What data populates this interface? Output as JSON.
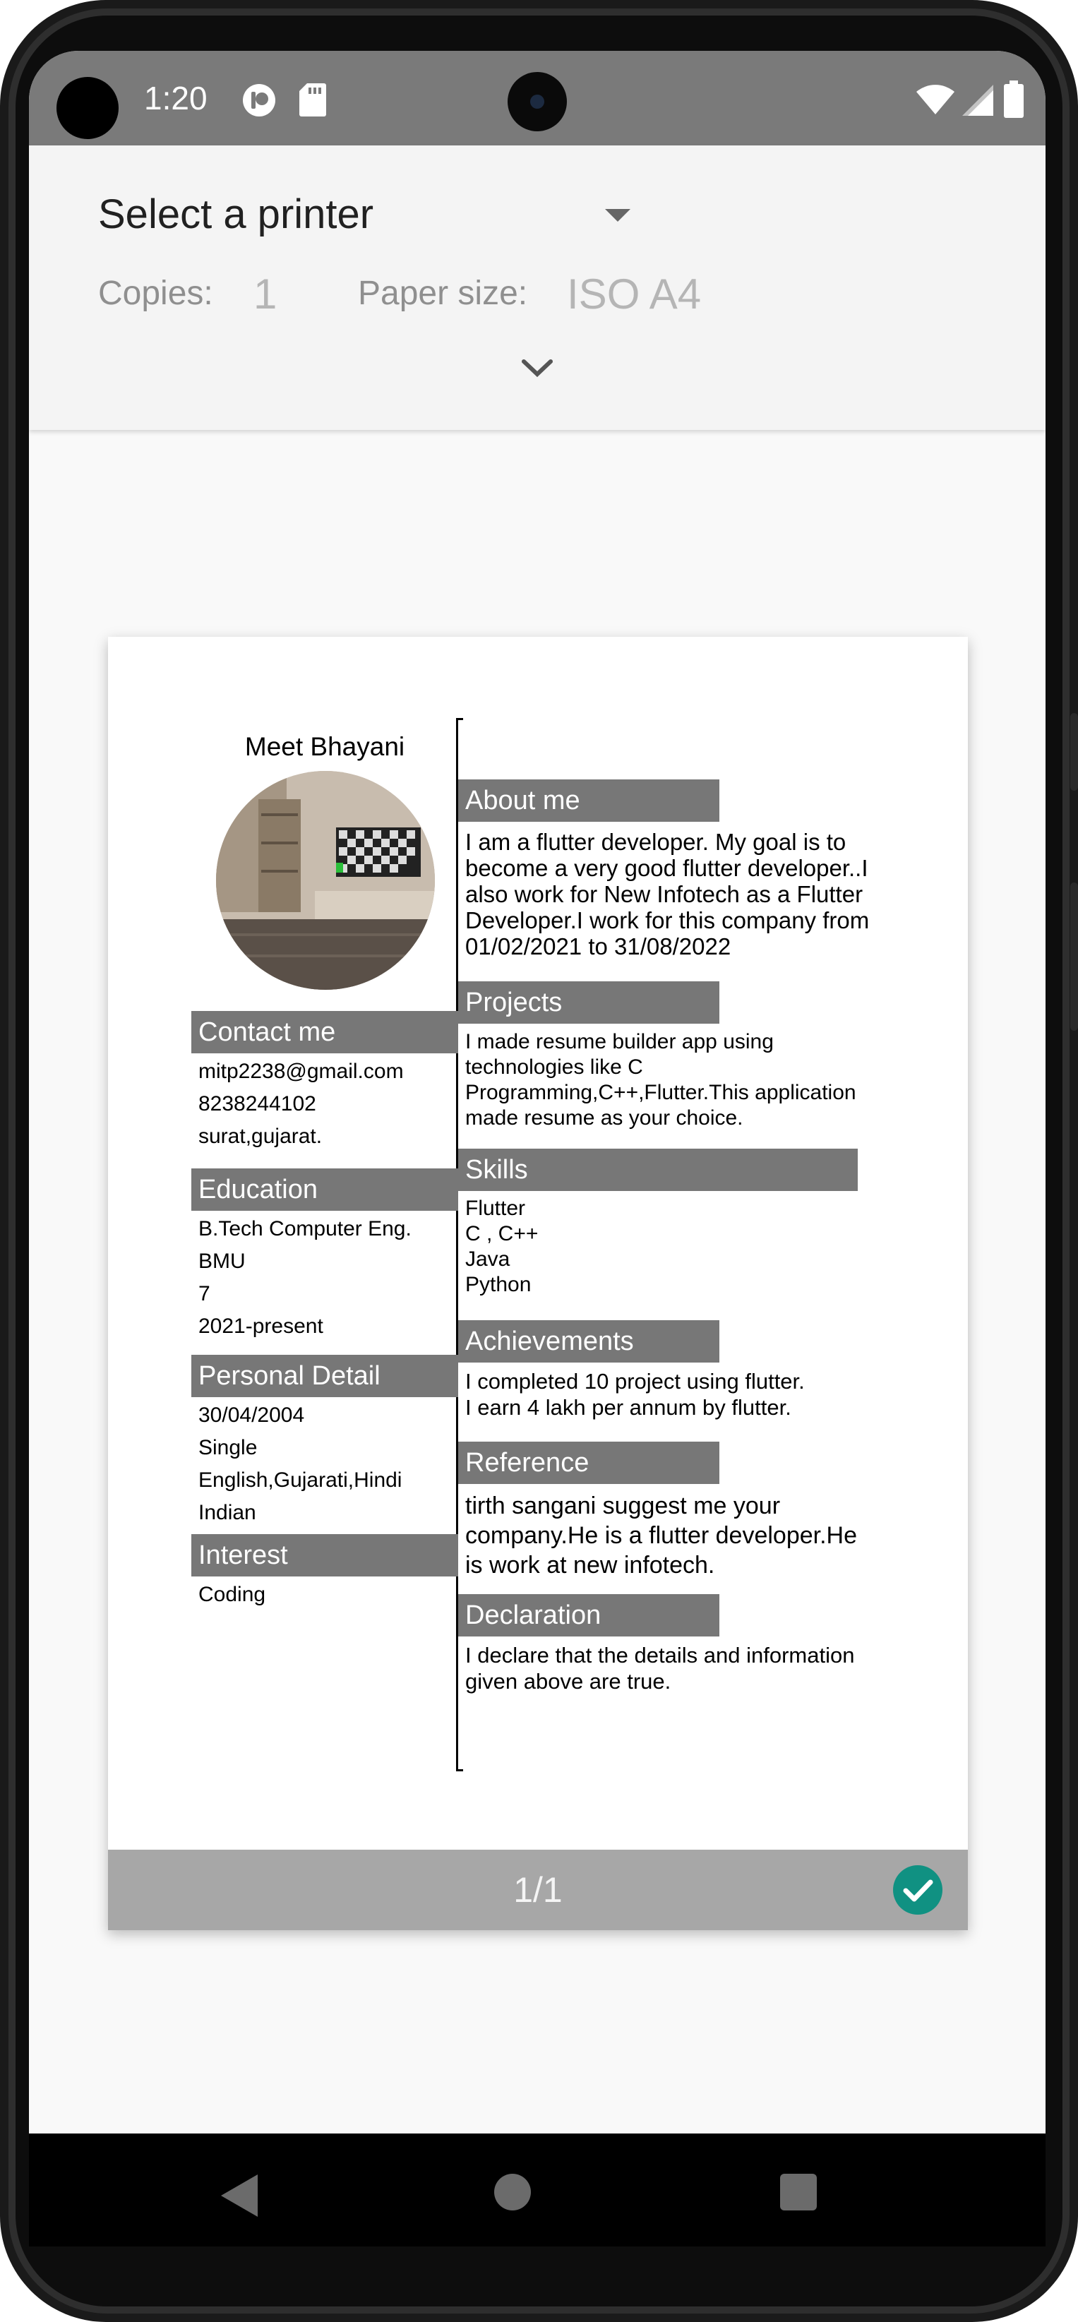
{
  "status_bar": {
    "time": "1:20",
    "icons": [
      "notification-app-icon",
      "sd-card-icon",
      "wifi-icon",
      "signal-icon",
      "battery-icon"
    ]
  },
  "print_options": {
    "printer_select": "Select a printer",
    "copies_label": "Copies:",
    "copies_value": "1",
    "paper_size_label": "Paper size:",
    "paper_size_value": "ISO A4"
  },
  "resume": {
    "name": "Meet Bhayani",
    "contact": {
      "heading": "Contact me",
      "email": "mitp2238@gmail.com",
      "phone": "8238244102",
      "address": "surat,gujarat."
    },
    "education": {
      "heading": "Education",
      "degree": "B.Tech Computer Eng.",
      "institute": "BMU",
      "score": "7",
      "years": "2021-present"
    },
    "personal": {
      "heading": "Personal Detail",
      "dob": "30/04/2004",
      "marital": "Single",
      "languages": "English,Gujarati,Hindi",
      "nationality": "Indian"
    },
    "interest": {
      "heading": "Interest",
      "value": "Coding"
    },
    "about": {
      "heading": "About me",
      "lines": [
        "I am a flutter developer. My goal is to",
        "become a very good flutter developer..I",
        "also work for New Infotech as a Flutter",
        "Developer.I work for this company from",
        "01/02/2021 to 31/08/2022"
      ]
    },
    "projects": {
      "heading": "Projects",
      "lines": [
        "I made resume builder app using",
        "technologies like C",
        "Programming,C++,Flutter.This application",
        "made resume as your choice."
      ]
    },
    "skills": {
      "heading": "Skills",
      "items": [
        "Flutter",
        "C , C++",
        "Java",
        "Python"
      ]
    },
    "achievements": {
      "heading": "Achievements",
      "lines": [
        "I completed 10 project using flutter.",
        "I earn 4 lakh per annum by flutter."
      ]
    },
    "reference": {
      "heading": "Reference",
      "lines": [
        "tirth sangani suggest me your",
        "company.He is a flutter developer.He",
        "is work at new infotech."
      ]
    },
    "declaration": {
      "heading": "Declaration",
      "lines": [
        "I declare that the details and information",
        "given above are true."
      ]
    }
  },
  "preview_footer": {
    "page_indicator": "1/1",
    "selected": true
  },
  "colors": {
    "status_bar": "#7a7a7a",
    "section_header": "#777777",
    "check_badge": "#109182",
    "page_footer": "#a7a7a7"
  }
}
